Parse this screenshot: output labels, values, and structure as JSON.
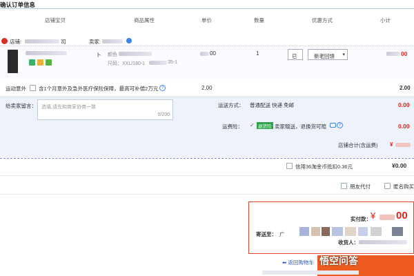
{
  "page": {
    "title": "确认订单信息"
  },
  "columns": [
    "店铺宝贝",
    "商品属性",
    "单价",
    "数量",
    "优惠方式",
    "小计"
  ],
  "shop": {
    "shop_label": "店铺:",
    "shop_name_tail": "司",
    "seller_label": "卖家:"
  },
  "item": {
    "title_fragment": "卜",
    "sku_label_1": "颜色",
    "sku_label_2": "尺码：XXL/180-1",
    "sku_tail": "35-1",
    "price": "00",
    "qty": "1",
    "promo_prefix": "已",
    "promo_select": "新老回馈",
    "subtotal": "00"
  },
  "insurance": {
    "label": "运动意外",
    "checkbox_text": "含1个月意外及急外医疗保险保障，最高可补偿2万元",
    "price": "2.00",
    "subtotal": "2.00"
  },
  "message": {
    "label": "给卖家留言：",
    "placeholder": "选填,请先和商家协商一致",
    "counter": "0/200"
  },
  "shipping": {
    "label": "运送方式：",
    "value": "普通配送 快递 免邮",
    "fee": "0.00"
  },
  "return_ins": {
    "label": "运费险：",
    "tag": "退货险",
    "text": "卖家赠送，退换货可赔",
    "fee": "0.00"
  },
  "shop_total": {
    "label": "店铺合计(含运费)",
    "value": "¥"
  },
  "coin": {
    "text": "信用36淘金币抵扣0.36元",
    "value": "¥0.00"
  },
  "options": {
    "friend_pay": "朋友代付",
    "anonymous": "匿名购买"
  },
  "payment": {
    "label": "实付款：",
    "amount_prefix": "¥",
    "amount_tail": "00",
    "ship_to_label": "寄送至：",
    "ship_to_value": "广",
    "receiver_label": "收货人："
  },
  "actions": {
    "back_to_cart": "返回购物车"
  },
  "watermark": "悟空问答",
  "colors": {
    "accent": "#ee5b1f",
    "price_red": "#e0241a",
    "link_blue": "#2a5cb8",
    "panel_bg": "#eef2fb"
  }
}
